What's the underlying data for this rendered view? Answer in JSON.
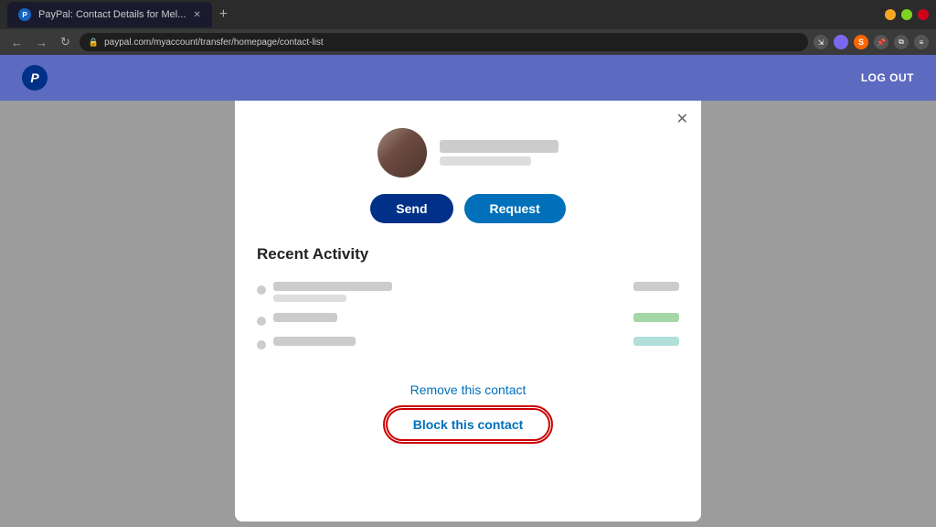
{
  "browser": {
    "tab_title": "PayPal: Contact Details for Mel...",
    "tab_favicon_label": "P",
    "url": "paypal.com/myaccount/transfer/homepage/contact-list",
    "new_tab_label": "+",
    "win_minimize": "–",
    "win_maximize": "□",
    "win_close": "✕"
  },
  "header": {
    "paypal_logo": "P",
    "logout_label": "LOG OUT"
  },
  "modal": {
    "close_icon": "✕",
    "send_label": "Send",
    "request_label": "Request",
    "recent_activity_title": "Recent Activity",
    "remove_label": "Remove this contact",
    "block_label": "Block this contact"
  }
}
